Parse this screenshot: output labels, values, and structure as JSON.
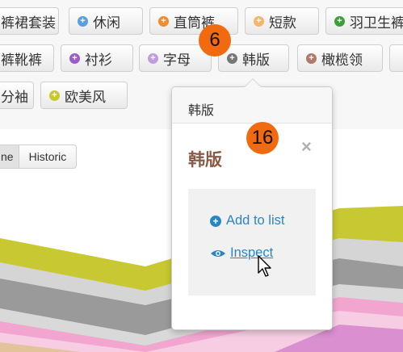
{
  "colors": {
    "blue": "#5a9fe0",
    "orange": "#f28b29",
    "light_orange": "#f5b56a",
    "green": "#3aa03a",
    "purple": "#9b5cc8",
    "light_purple": "#c19be0",
    "gray": "#777777",
    "brown": "#b07a6b",
    "olive": "#c8c832",
    "pink": "#e39bd1",
    "link_blue": "#2a86c2",
    "badge_orange": "#f26a0f"
  },
  "tags": {
    "row1": [
      {
        "label": "裤裙套装",
        "icon": "none-icon"
      },
      {
        "label": "休闲",
        "icon": "plus-icon",
        "color": "blue"
      },
      {
        "label": "直筒裤",
        "icon": "plus-icon",
        "color": "orange"
      },
      {
        "label": "短款",
        "icon": "plus-icon",
        "color": "light_orange"
      },
      {
        "label": "羽卫生裤",
        "icon": "plus-icon",
        "color": "green"
      }
    ],
    "row2": [
      {
        "label": "裤靴裤",
        "icon": "none-icon"
      },
      {
        "label": "衬衫",
        "icon": "plus-icon",
        "color": "purple"
      },
      {
        "label": "字母",
        "icon": "plus-icon",
        "color": "light_purple"
      },
      {
        "label": "韩版",
        "icon": "plus-icon",
        "color": "gray"
      },
      {
        "label": "橄榄领",
        "icon": "plus-icon",
        "color": "brown"
      }
    ],
    "row3": [
      {
        "label": "分袖",
        "icon": "none-icon"
      },
      {
        "label": "欧美风",
        "icon": "plus-icon",
        "color": "olive"
      }
    ]
  },
  "view_toggle": {
    "partial_label": "ne",
    "historic_label": "Historic"
  },
  "popover": {
    "header": "韩版",
    "title": "韩版",
    "close_glyph": "×",
    "add_label": "Add to list",
    "inspect_label": "Inspect"
  },
  "badges": [
    "6",
    "16"
  ]
}
